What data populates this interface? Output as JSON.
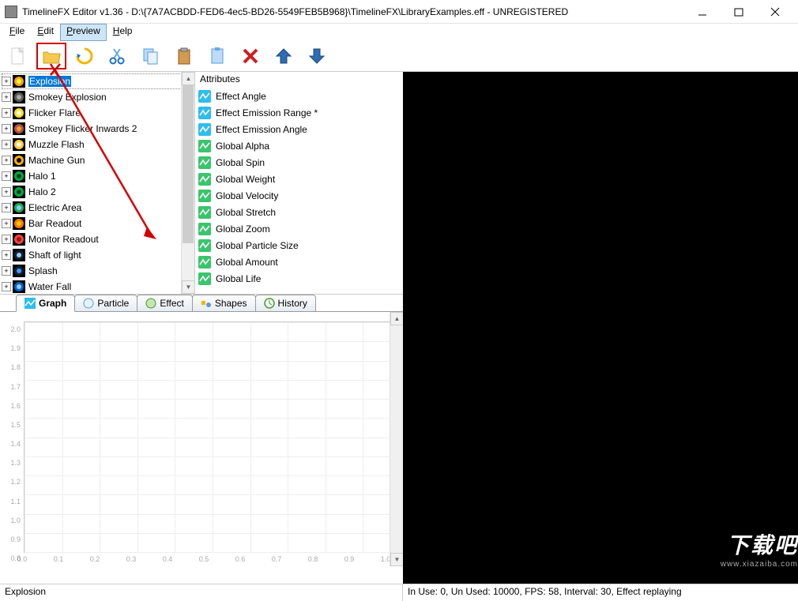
{
  "window": {
    "title": "TimelineFX Editor v1.36 - D:\\{7A7ACBDD-FED6-4ec5-BD26-5549FEB5B968}\\TimelineFX\\LibraryExamples.eff - UNREGISTERED"
  },
  "menu": {
    "file": "File",
    "edit": "Edit",
    "preview": "Preview",
    "help": "Help"
  },
  "toolbar_icons": {
    "new": "new-file",
    "open": "open-folder",
    "refresh": "refresh",
    "cut": "cut",
    "copy": "copy",
    "paste": "paste-clipboard",
    "paste2": "paste-clipboard-2",
    "delete": "delete",
    "up": "move-up",
    "down": "move-down"
  },
  "tree": {
    "items": [
      {
        "label": "Explosion",
        "icon": "explosion",
        "selected": true
      },
      {
        "label": "Smokey Explosion",
        "icon": "smoke"
      },
      {
        "label": "Flicker Flare",
        "icon": "flare"
      },
      {
        "label": "Smokey Flicker Inwards 2",
        "icon": "smokeflicker"
      },
      {
        "label": "Muzzle Flash",
        "icon": "muzzle"
      },
      {
        "label": "Machine Gun",
        "icon": "gun"
      },
      {
        "label": "Halo 1",
        "icon": "halo"
      },
      {
        "label": "Halo 2",
        "icon": "halo"
      },
      {
        "label": "Electric Area",
        "icon": "electric"
      },
      {
        "label": "Bar Readout",
        "icon": "bars"
      },
      {
        "label": "Monitor Readout",
        "icon": "monitor"
      },
      {
        "label": "Shaft of light",
        "icon": "shaft"
      },
      {
        "label": "Splash",
        "icon": "splash"
      },
      {
        "label": "Water Fall",
        "icon": "water"
      }
    ]
  },
  "attributes": {
    "header": "Attributes",
    "items": [
      {
        "label": "Effect Angle",
        "type": "blue"
      },
      {
        "label": "Effect Emission Range *",
        "type": "blue"
      },
      {
        "label": "Effect Emission Angle",
        "type": "blue"
      },
      {
        "label": "Global Alpha",
        "type": "green"
      },
      {
        "label": "Global Spin",
        "type": "green"
      },
      {
        "label": "Global Weight",
        "type": "green"
      },
      {
        "label": "Global Velocity",
        "type": "green"
      },
      {
        "label": "Global Stretch",
        "type": "green"
      },
      {
        "label": "Global Zoom",
        "type": "green"
      },
      {
        "label": "Global Particle Size",
        "type": "green"
      },
      {
        "label": "Global Amount",
        "type": "green"
      },
      {
        "label": "Global Life",
        "type": "green"
      }
    ]
  },
  "tabs": {
    "graph": "Graph",
    "particle": "Particle",
    "effect": "Effect",
    "shapes": "Shapes",
    "history": "History"
  },
  "chart_data": {
    "type": "line",
    "title": "",
    "xlabel": "",
    "ylabel": "",
    "x_ticks": [
      "0.0",
      "0.1",
      "0.2",
      "0.3",
      "0.4",
      "0.5",
      "0.6",
      "0.7",
      "0.8",
      "0.9",
      "1.0"
    ],
    "y_ticks": [
      "0.8",
      "0.9",
      "1.0",
      "1.1",
      "1.2",
      "1.3",
      "1.4",
      "1.5",
      "1.6",
      "1.7",
      "1.8",
      "1.9",
      "2.0"
    ],
    "xlim": [
      0.0,
      1.0
    ],
    "ylim": [
      0.8,
      2.0
    ],
    "series": []
  },
  "status": {
    "left": "Explosion",
    "right": "In Use: 0, Un Used: 10000, FPS: 58, Interval: 30, Effect replaying"
  },
  "watermark": {
    "big": "下载吧",
    "small": "www.xiazaiba.com"
  }
}
